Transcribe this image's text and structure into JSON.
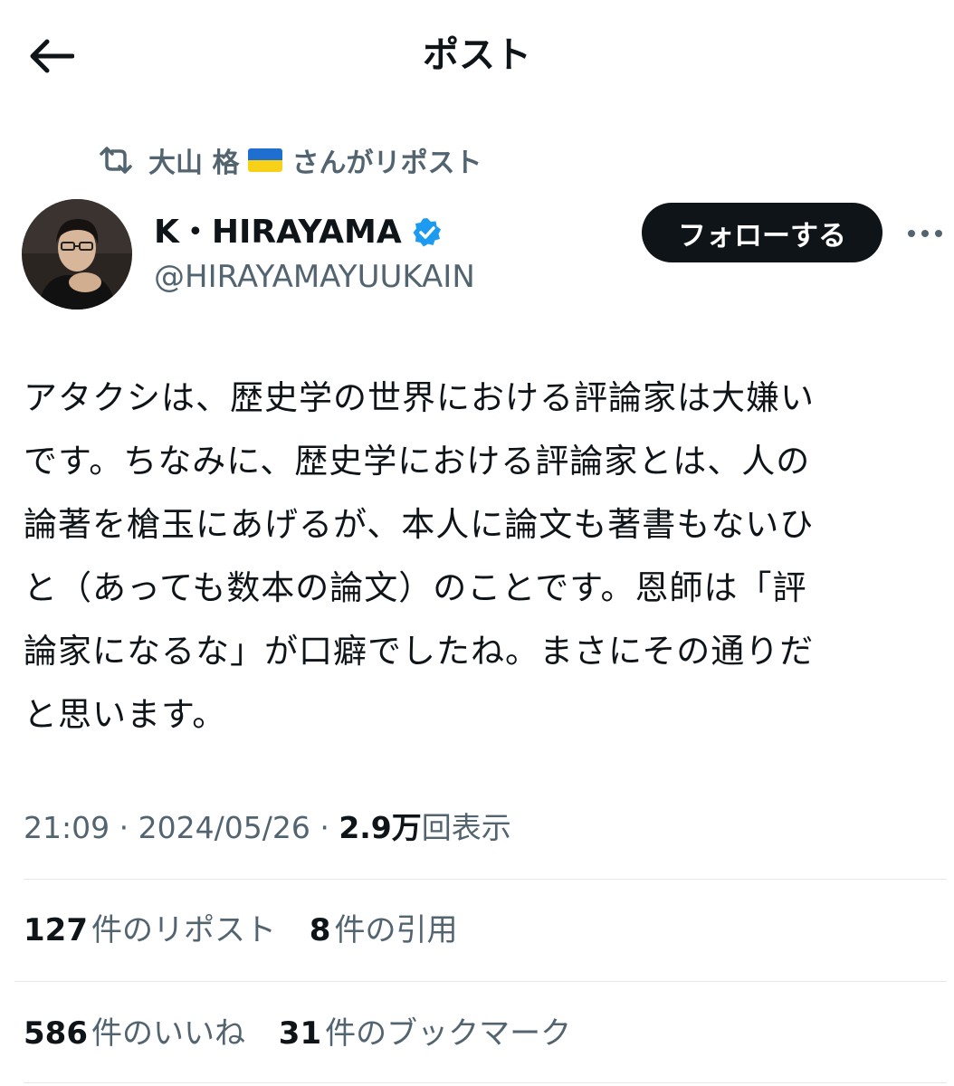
{
  "header": {
    "title": "ポスト"
  },
  "repost": {
    "user": "大山 格",
    "suffix": "さんがリポスト"
  },
  "author": {
    "name": "K・HIRAYAMA",
    "handle": "@HIRAYAMAYUUKAIN",
    "follow_label": "フォローする"
  },
  "post": {
    "lines": [
      "アタクシは、歴史学の世界における評論家は大嫌い",
      "です。ちなみに、歴史学における評論家とは、人の",
      "論著を槍玉にあげるが、本人に論文も著書もないひ",
      "と（あっても数本の論文）のことです。恩師は「評",
      "論家になるな」が口癖でしたね。まさにその通りだ",
      "と思います。"
    ]
  },
  "meta": {
    "time": "21:09",
    "date": "2024/05/26",
    "separator": "·",
    "views_count": "2.9万",
    "views_label": "回表示"
  },
  "stats": {
    "reposts_count": "127",
    "reposts_label": "件のリポスト",
    "quotes_count": "8",
    "quotes_label": "件の引用",
    "likes_count": "586",
    "likes_label": "件のいいね",
    "bookmarks_count": "31",
    "bookmarks_label": "件のブックマーク"
  },
  "colors": {
    "text": "#0f1419",
    "secondary": "#536471",
    "verified": "#1d9bf0",
    "flag_blue": "#1f6fd1",
    "flag_yellow": "#f7d118"
  }
}
